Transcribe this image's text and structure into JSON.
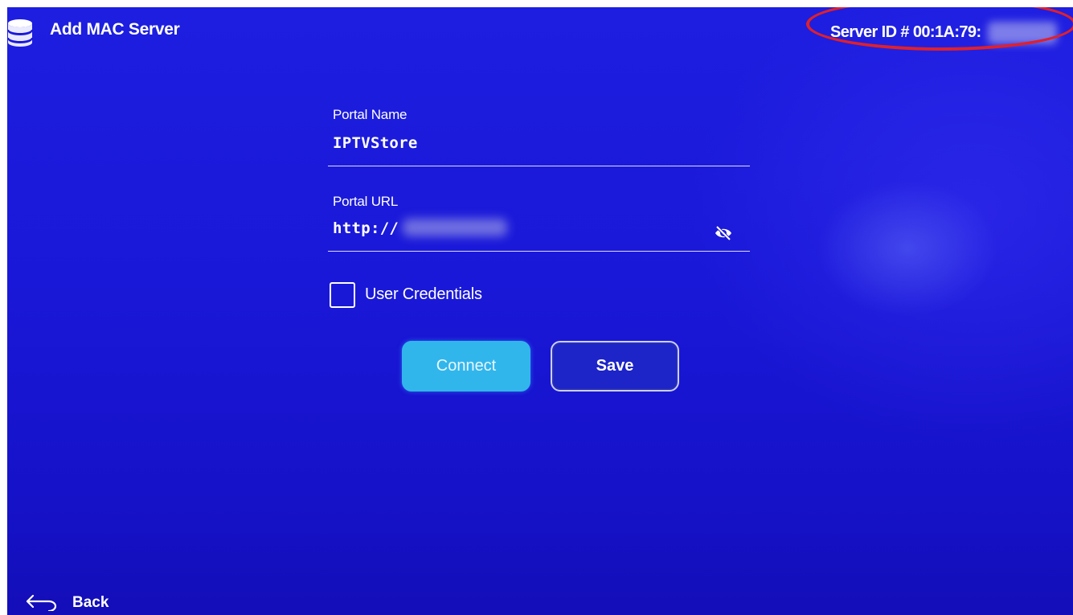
{
  "header": {
    "icon": "database-icon",
    "title": "Add MAC Server",
    "server_id": "Server ID # 00:1A:79:"
  },
  "form": {
    "portal_name": {
      "label": "Portal Name",
      "value": "IPTVStore"
    },
    "portal_url": {
      "label": "Portal URL",
      "value": "http://",
      "visibility_icon": "eye-off-icon"
    },
    "user_credentials": {
      "label": "User Credentials",
      "checked": false
    }
  },
  "actions": {
    "connect_label": "Connect",
    "save_label": "Save"
  },
  "footer": {
    "back_icon": "back-arrow-icon",
    "back_label": "Back"
  },
  "colors": {
    "background": "#1a18d8",
    "connect_button": "#31b6ec",
    "annotation_circle": "#e0202a"
  }
}
